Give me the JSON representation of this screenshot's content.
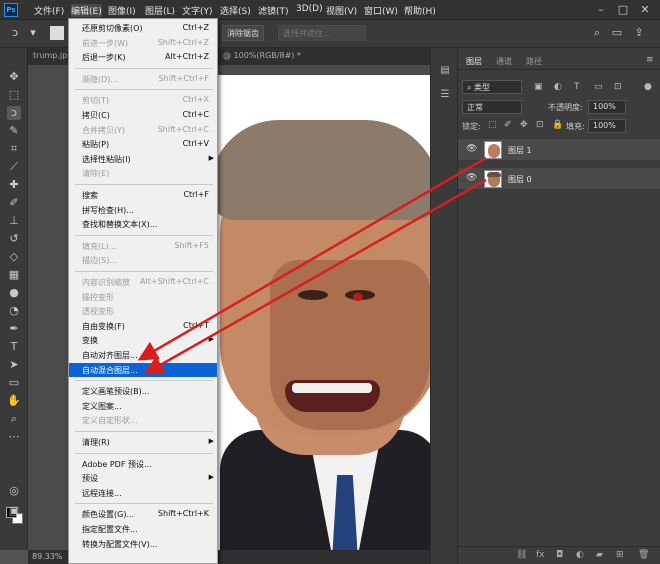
{
  "app": {
    "logo": "Ps"
  },
  "menubar": {
    "items": [
      "文件(F)",
      "编辑(E)",
      "图像(I)",
      "图层(L)",
      "文字(Y)",
      "选择(S)",
      "滤镜(T)",
      "3D(D)",
      "视图(V)",
      "窗口(W)",
      "帮助(H)"
    ],
    "active_index": 1
  },
  "options_bar": {
    "select_subject": "选择主体",
    "select_mask": "选择并遮住...",
    "feather_label": "消除锯齿"
  },
  "tabs": [
    {
      "label": "trump.jp"
    },
    {
      "label": "@ 100%(RGB/8#) *"
    }
  ],
  "edit_menu": {
    "items": [
      {
        "label": "还原剪切像素(O)",
        "shortcut": "Ctrl+Z",
        "disabled": false
      },
      {
        "label": "前进一步(W)",
        "shortcut": "Shift+Ctrl+Z",
        "disabled": true
      },
      {
        "label": "后退一步(K)",
        "shortcut": "Alt+Ctrl+Z",
        "disabled": false
      },
      {
        "separator": true
      },
      {
        "label": "渐隐(D)...",
        "shortcut": "Shift+Ctrl+F",
        "disabled": true
      },
      {
        "separator": true
      },
      {
        "label": "剪切(T)",
        "shortcut": "Ctrl+X",
        "disabled": true
      },
      {
        "label": "拷贝(C)",
        "shortcut": "Ctrl+C",
        "disabled": false
      },
      {
        "label": "合并拷贝(Y)",
        "shortcut": "Shift+Ctrl+C",
        "disabled": true
      },
      {
        "label": "粘贴(P)",
        "shortcut": "Ctrl+V",
        "disabled": false
      },
      {
        "label": "选择性粘贴(I)",
        "shortcut": "",
        "disabled": false,
        "submenu": true
      },
      {
        "label": "清除(E)",
        "shortcut": "",
        "disabled": true
      },
      {
        "separator": true
      },
      {
        "label": "搜索",
        "shortcut": "Ctrl+F",
        "disabled": false
      },
      {
        "label": "拼写检查(H)...",
        "shortcut": "",
        "disabled": false
      },
      {
        "label": "查找和替换文本(X)...",
        "shortcut": "",
        "disabled": false
      },
      {
        "separator": true
      },
      {
        "label": "填充(L)...",
        "shortcut": "Shift+F5",
        "disabled": true
      },
      {
        "label": "描边(S)...",
        "shortcut": "",
        "disabled": true
      },
      {
        "separator": true
      },
      {
        "label": "内容识别缩放",
        "shortcut": "Alt+Shift+Ctrl+C",
        "disabled": true
      },
      {
        "label": "操控变形",
        "shortcut": "",
        "disabled": true
      },
      {
        "label": "透视变形",
        "shortcut": "",
        "disabled": true
      },
      {
        "label": "自由变换(F)",
        "shortcut": "Ctrl+T",
        "disabled": false
      },
      {
        "label": "变换",
        "shortcut": "",
        "disabled": false,
        "submenu": true
      },
      {
        "label": "自动对齐图层...",
        "shortcut": "",
        "disabled": false
      },
      {
        "label": "自动混合图层...",
        "shortcut": "",
        "disabled": false,
        "highlight": true
      },
      {
        "separator": true
      },
      {
        "label": "定义画笔预设(B)...",
        "shortcut": "",
        "disabled": false
      },
      {
        "label": "定义图案...",
        "shortcut": "",
        "disabled": false
      },
      {
        "label": "定义自定形状...",
        "shortcut": "",
        "disabled": true
      },
      {
        "separator": true
      },
      {
        "label": "清理(R)",
        "shortcut": "",
        "disabled": false,
        "submenu": true
      },
      {
        "separator": true
      },
      {
        "label": "Adobe PDF 预设...",
        "shortcut": "",
        "disabled": false
      },
      {
        "label": "预设",
        "shortcut": "",
        "disabled": false,
        "submenu": true
      },
      {
        "label": "远程连接...",
        "shortcut": "",
        "disabled": false
      },
      {
        "separator": true
      },
      {
        "label": "颜色设置(G)...",
        "shortcut": "Shift+Ctrl+K",
        "disabled": false
      },
      {
        "label": "指定配置文件...",
        "shortcut": "",
        "disabled": false
      },
      {
        "label": "转换为配置文件(V)...",
        "shortcut": "",
        "disabled": false
      }
    ]
  },
  "layers_panel": {
    "tabs": [
      "图层",
      "通道",
      "路径"
    ],
    "filter_kind": "类型",
    "blend_mode": "正常",
    "opacity_label": "不透明度:",
    "opacity_value": "100%",
    "lock_label": "锁定:",
    "fill_label": "填充:",
    "fill_value": "100%",
    "layers": [
      {
        "name": "图层 1"
      },
      {
        "name": "图层 0"
      }
    ]
  },
  "status": {
    "zoom": "89.33%"
  },
  "colors": {
    "annotation_red": "#d81e1e",
    "menu_highlight": "#0a64d6"
  }
}
